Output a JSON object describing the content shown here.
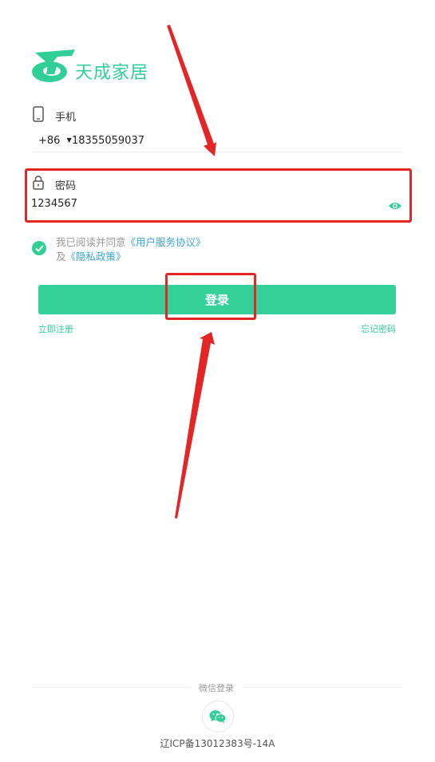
{
  "brand": {
    "name": "天成家居",
    "color": "#2fcf95"
  },
  "phone": {
    "label": "手机",
    "icon": "phone-icon",
    "country_code": "+86",
    "value": "18355059037"
  },
  "password": {
    "label": "密码",
    "icon": "lock-icon",
    "value": "1234567",
    "toggle_icon": "eye-icon"
  },
  "agreement": {
    "prefix": "我已阅读并同意",
    "terms_link": "《用户服务协议》",
    "and": "及",
    "privacy_link": "《隐私政策》",
    "checked": true
  },
  "actions": {
    "login_label": "登录",
    "register_label": "立即注册",
    "forgot_label": "忘记密码"
  },
  "footer": {
    "wechat_login_label": "微信登录",
    "wechat_icon": "wechat-icon",
    "icp": "辽ICP备13012383号-14A"
  },
  "colors": {
    "accent": "#33d09a",
    "annotation": "#e32525",
    "link": "#3aa7d8"
  }
}
